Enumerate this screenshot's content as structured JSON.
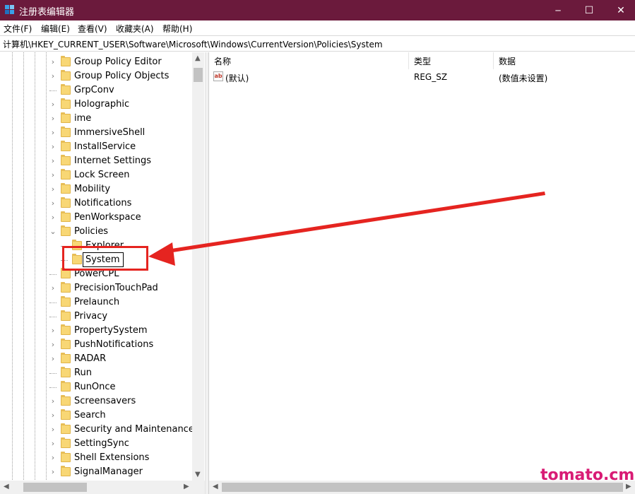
{
  "window": {
    "title": "注册表编辑器",
    "minimize_glyph": "─",
    "maximize_glyph": "☐",
    "close_glyph": "✕"
  },
  "menu": [
    "文件(F)",
    "编辑(E)",
    "查看(V)",
    "收藏夹(A)",
    "帮助(H)"
  ],
  "address": "计算机\\HKEY_CURRENT_USER\\Software\\Microsoft\\Windows\\CurrentVersion\\Policies\\System",
  "tree": {
    "items": [
      {
        "label": "Group Policy Editor",
        "expander": "right"
      },
      {
        "label": "Group Policy Objects",
        "expander": "right"
      },
      {
        "label": "GrpConv",
        "expander": "none"
      },
      {
        "label": "Holographic",
        "expander": "right"
      },
      {
        "label": "ime",
        "expander": "right"
      },
      {
        "label": "ImmersiveShell",
        "expander": "right"
      },
      {
        "label": "InstallService",
        "expander": "right"
      },
      {
        "label": "Internet Settings",
        "expander": "right"
      },
      {
        "label": "Lock Screen",
        "expander": "right"
      },
      {
        "label": "Mobility",
        "expander": "right"
      },
      {
        "label": "Notifications",
        "expander": "right"
      },
      {
        "label": "PenWorkspace",
        "expander": "right"
      },
      {
        "label": "Policies",
        "expander": "down"
      },
      {
        "label": "Explorer",
        "expander": "none",
        "child": true
      },
      {
        "label": "System",
        "expander": "none",
        "child": true,
        "editing": true
      },
      {
        "label": "PowerCPL",
        "expander": "none"
      },
      {
        "label": "PrecisionTouchPad",
        "expander": "right"
      },
      {
        "label": "Prelaunch",
        "expander": "none"
      },
      {
        "label": "Privacy",
        "expander": "none"
      },
      {
        "label": "PropertySystem",
        "expander": "right"
      },
      {
        "label": "PushNotifications",
        "expander": "right"
      },
      {
        "label": "RADAR",
        "expander": "right"
      },
      {
        "label": "Run",
        "expander": "none"
      },
      {
        "label": "RunOnce",
        "expander": "none"
      },
      {
        "label": "Screensavers",
        "expander": "right"
      },
      {
        "label": "Search",
        "expander": "right"
      },
      {
        "label": "Security and Maintenance",
        "expander": "right"
      },
      {
        "label": "SettingSync",
        "expander": "right"
      },
      {
        "label": "Shell Extensions",
        "expander": "right"
      },
      {
        "label": "SignalManager",
        "expander": "right"
      }
    ],
    "rename_value": "System"
  },
  "list": {
    "columns": {
      "name": "名称",
      "type": "类型",
      "data": "数据"
    },
    "rows": [
      {
        "icon": "ab-string-icon",
        "icon_text": "ab",
        "name": "(默认)",
        "type": "REG_SZ",
        "data": "(数值未设置)"
      }
    ]
  },
  "annotation": {
    "color": "#e52420"
  },
  "watermark": "tomato.cm",
  "colors": {
    "titlebar": "#6b1a3c",
    "folder": "#f8d775",
    "watermark": "#d81b74"
  }
}
